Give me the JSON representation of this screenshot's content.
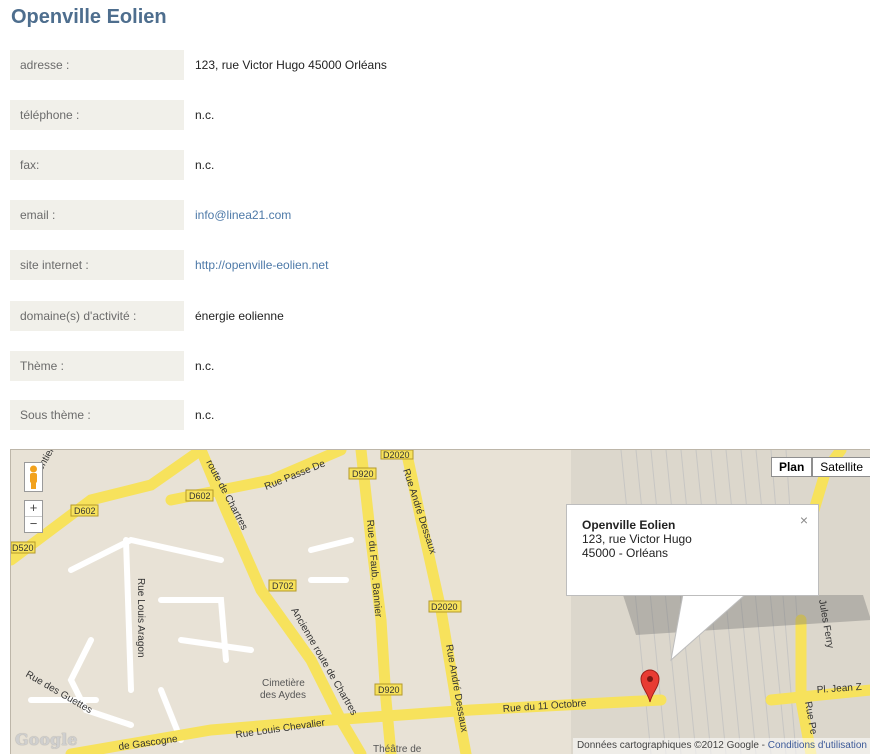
{
  "page": {
    "title": "Openville Eolien"
  },
  "rows": [
    {
      "label": "adresse :",
      "value": "123, rue Victor Hugo 45000 Orléans",
      "link": false
    },
    {
      "label": "téléphone :",
      "value": "n.c.",
      "link": false
    },
    {
      "label": "fax:",
      "value": "n.c.",
      "link": false
    },
    {
      "label": "email :",
      "value": "info@linea21.com",
      "link": true
    },
    {
      "label": "site internet :",
      "value": "http://openville-eolien.net",
      "link": true
    },
    {
      "label": "domaine(s) d'activité :",
      "value": "énergie eolienne",
      "link": false
    },
    {
      "label": "Thème :",
      "value": "n.c.",
      "link": false
    },
    {
      "label": "Sous thème :",
      "value": "n.c.",
      "link": false
    }
  ],
  "map": {
    "controls": {
      "zoom_in": "+",
      "zoom_out": "−",
      "plan": "Plan",
      "satellite": "Satellite"
    },
    "info_window": {
      "name": "Openville Eolien",
      "line1": "123, rue Victor Hugo",
      "line2": "45000 - Orléans",
      "close": "×"
    },
    "streets": {
      "tangentielle": "Tangentielle",
      "passe": "Rue Passe De",
      "route_chartres": "route de Chartres",
      "ancienne": "Ancienne route de Chartres",
      "faub": "Rue du Faub. Bannier",
      "andre_top": "Rue André Dessaux",
      "andre_bottom": "Rue André Dessaux",
      "louis_aragon": "Rue Louis Aragon",
      "guettes": "Rue des Guettes",
      "octobre": "Rue du 11 Octobre",
      "chevalier": "Rue Louis Chevalier",
      "gascogne": "de Gascogne",
      "jules": "Jules Ferry",
      "jean": "Pl. Jean Z",
      "rue_pe": "Rue Pe",
      "cemetery_1": "Cimetière",
      "cemetery_2": "des Aydes",
      "theatre": "Théâtre de"
    },
    "shields": {
      "d602_a": "D602",
      "d602_b": "D602",
      "d520": "D520",
      "d920_a": "D920",
      "d920_b": "D920",
      "d2020_a": "D2020",
      "d2020_b": "D2020",
      "d702": "D702"
    },
    "logo": "Google",
    "attribution": "Données cartographiques ©2012 Google",
    "terms_sep": " - ",
    "terms": "Conditions d'utilisation"
  }
}
